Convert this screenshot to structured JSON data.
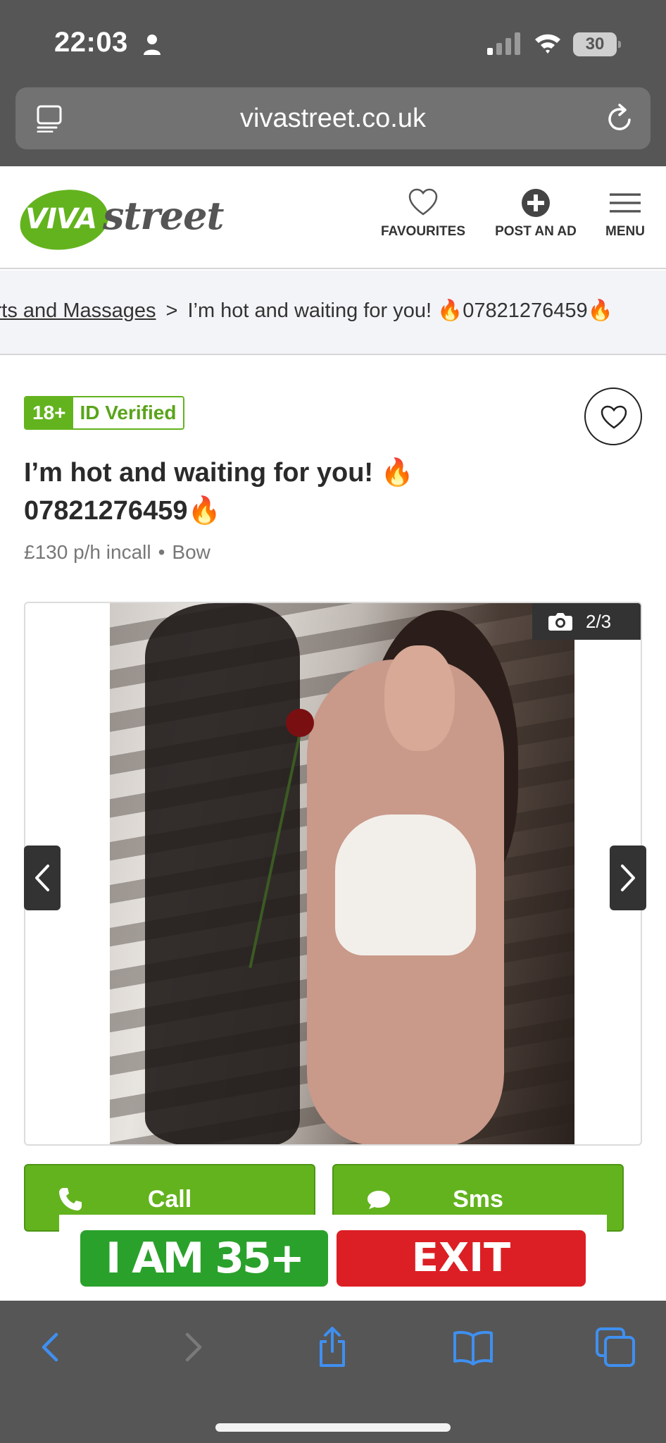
{
  "status_bar": {
    "time": "22:03",
    "battery": "30"
  },
  "url_bar": {
    "url": "vivastreet.co.uk"
  },
  "header": {
    "logo_viva": "VIVA",
    "logo_street": "street",
    "nav": {
      "favourites": "FAVOURITES",
      "post_ad": "POST AN AD",
      "menu": "MENU"
    }
  },
  "breadcrumb": {
    "link": "corts and Massages",
    "separator": ">",
    "current": "I’m hot and waiting for you! 🔥07821276459🔥"
  },
  "listing": {
    "badge_age": "18+",
    "badge_id": "ID Verified",
    "title_line1": "I’m hot and waiting for you! 🔥",
    "title_line2": "07821276459🔥",
    "price": "£130 p/h incall",
    "dot": "•",
    "location": "Bow",
    "photo_counter": "2/3"
  },
  "actions": {
    "call": "Call",
    "sms": "Sms"
  },
  "age_banner": {
    "confirm": "I AM 35+",
    "exit": "EXIT"
  },
  "colors": {
    "brand_green": "#63b31e",
    "exit_red": "#dc1f24",
    "ios_blue": "#3f8ff0"
  },
  "icons": [
    "person-icon",
    "signal-icon",
    "wifi-icon",
    "reader-icon",
    "reload-icon",
    "heart-icon",
    "plus-circle-icon",
    "hamburger-icon",
    "camera-icon",
    "chevron-left-icon",
    "chevron-right-icon",
    "phone-icon",
    "chat-bubble-icon",
    "share-icon",
    "book-icon",
    "tabs-icon"
  ]
}
